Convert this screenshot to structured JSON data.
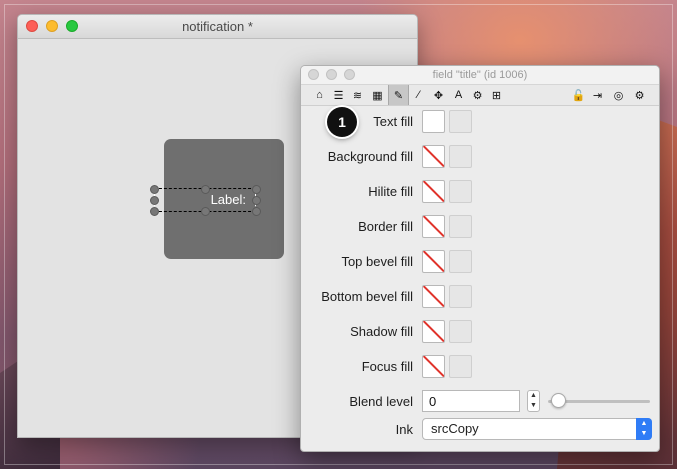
{
  "main_window": {
    "title": "notification *",
    "label_text": "Label:"
  },
  "inspector": {
    "title": "field \"title\" (id 1006)",
    "toolbar": [
      {
        "icon": "home-icon",
        "glyph": "⌂"
      },
      {
        "icon": "list-icon",
        "glyph": "☰"
      },
      {
        "icon": "database-icon",
        "glyph": "≋"
      },
      {
        "icon": "table-icon",
        "glyph": "▦"
      },
      {
        "icon": "pencil-icon",
        "glyph": "✎",
        "active": true
      },
      {
        "icon": "wand-icon",
        "glyph": "⁄"
      },
      {
        "icon": "move-icon",
        "glyph": "✥"
      },
      {
        "icon": "text-icon",
        "glyph": "A"
      },
      {
        "icon": "gears-icon",
        "glyph": "⚙"
      },
      {
        "icon": "resize-icon",
        "glyph": "⊞"
      },
      {
        "icon": "unlock-icon",
        "glyph": "🔓"
      },
      {
        "icon": "exit-icon",
        "glyph": "⇥"
      },
      {
        "icon": "target-icon",
        "glyph": "◎"
      },
      {
        "icon": "gear-icon",
        "glyph": "⚙"
      }
    ],
    "fills": [
      {
        "label": "Text fill",
        "filled": true
      },
      {
        "label": "Background fill",
        "filled": false
      },
      {
        "label": "Hilite fill",
        "filled": false
      },
      {
        "label": "Border fill",
        "filled": false
      },
      {
        "label": "Top bevel fill",
        "filled": false
      },
      {
        "label": "Bottom bevel fill",
        "filled": false
      },
      {
        "label": "Shadow fill",
        "filled": false
      },
      {
        "label": "Focus fill",
        "filled": false
      }
    ],
    "blend": {
      "label": "Blend level",
      "value": "0",
      "slider_fraction": 0
    },
    "ink": {
      "label": "Ink",
      "value": "srcCopy"
    }
  },
  "callout": {
    "number": "1"
  },
  "colors": {
    "accent": "#2f7cf6",
    "empty_slash": "#e0322a"
  }
}
